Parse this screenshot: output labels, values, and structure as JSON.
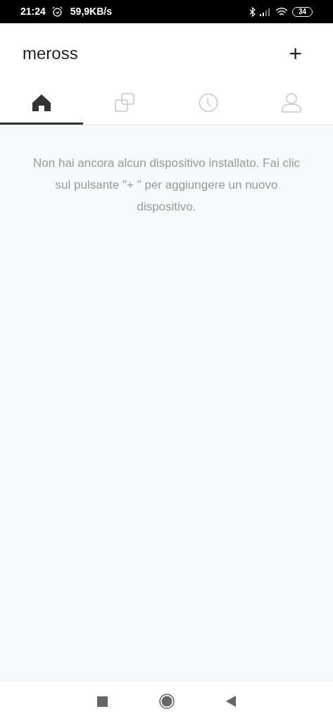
{
  "status_bar": {
    "time": "21:24",
    "speed": "59,9KB/s",
    "battery": "34"
  },
  "header": {
    "title": "meross",
    "add_label": "+"
  },
  "tabs": [
    {
      "kind": "home",
      "selected": true
    },
    {
      "kind": "devices",
      "selected": false
    },
    {
      "kind": "timer",
      "selected": false
    },
    {
      "kind": "profile",
      "selected": false
    }
  ],
  "empty_message": "Non hai ancora alcun dispositivo installato. Fai clic sul pulsante \"+ \" per aggiungere un nuovo dispositivo."
}
